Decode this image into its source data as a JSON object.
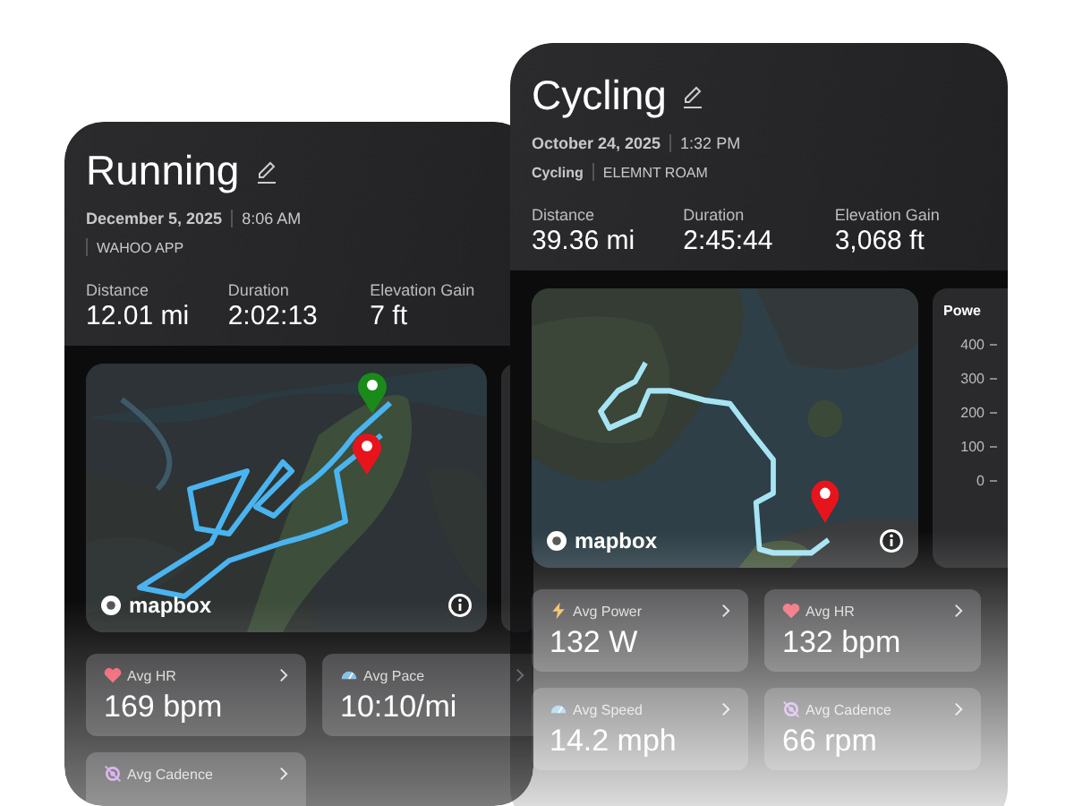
{
  "cards": [
    {
      "title": "Running",
      "date": "December 5, 2025",
      "time": "8:06 AM",
      "device": "WAHOO APP",
      "stats": [
        {
          "label": "Distance",
          "value": "12.01 mi"
        },
        {
          "label": "Duration",
          "value": "2:02:13"
        },
        {
          "label": "Elevation Gain",
          "value": "7 ft"
        }
      ],
      "map_logo": "mapbox",
      "metrics": [
        {
          "kind": "heart",
          "label": "Avg HR",
          "value": "169 bpm"
        },
        {
          "kind": "pace",
          "label": "Avg Pace",
          "value": "10:10/mi"
        },
        {
          "kind": "cadence",
          "label": "Avg Cadence"
        }
      ]
    },
    {
      "title": "Cycling",
      "date": "October 24, 2025",
      "time": "1:32 PM",
      "sport": "Cycling",
      "device": "ELEMNT ROAM",
      "stats": [
        {
          "label": "Distance",
          "value": "39.36 mi"
        },
        {
          "label": "Duration",
          "value": "2:45:44"
        },
        {
          "label": "Elevation Gain",
          "value": "3,068 ft"
        }
      ],
      "map_logo": "mapbox",
      "side_panel": {
        "title": "Powe",
        "ticks": [
          "400",
          "300",
          "200",
          "100",
          "0"
        ]
      },
      "metrics": [
        {
          "kind": "power",
          "label": "Avg Power",
          "value": "132 W"
        },
        {
          "kind": "heart",
          "label": "Avg HR",
          "value": "132 bpm"
        },
        {
          "kind": "pace",
          "label": "Avg Speed",
          "value": "14.2 mph"
        },
        {
          "kind": "cadence",
          "label": "Avg Cadence",
          "value": "66 rpm"
        }
      ]
    }
  ]
}
